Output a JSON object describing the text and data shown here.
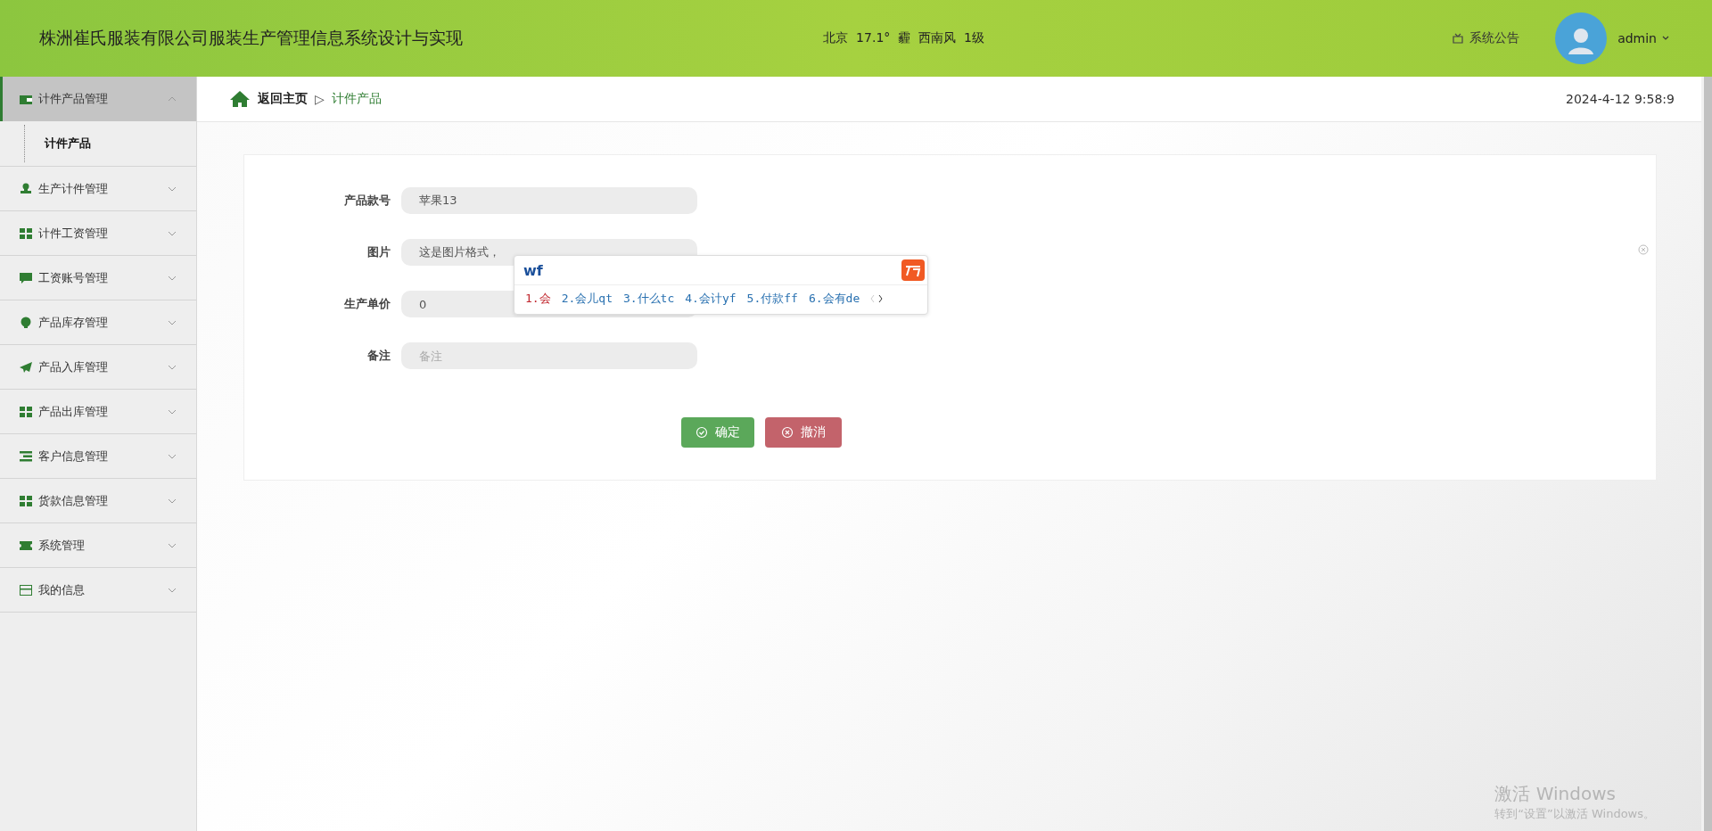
{
  "header": {
    "title": "株洲崔氏服装有限公司服装生产管理信息系统设计与实现",
    "weather": "北京  17.1°  霾  西南风  1级",
    "notice": "系统公告",
    "user": "admin"
  },
  "sidebar": {
    "items": [
      {
        "label": "计件产品管理",
        "expanded": true,
        "children": [
          {
            "label": "计件产品",
            "selected": true
          }
        ]
      },
      {
        "label": "生产计件管理",
        "expanded": false
      },
      {
        "label": "计件工资管理",
        "expanded": false
      },
      {
        "label": "工资账号管理",
        "expanded": false
      },
      {
        "label": "产品库存管理",
        "expanded": false
      },
      {
        "label": "产品入库管理",
        "expanded": false
      },
      {
        "label": "产品出库管理",
        "expanded": false
      },
      {
        "label": "客户信息管理",
        "expanded": false
      },
      {
        "label": "货款信息管理",
        "expanded": false
      },
      {
        "label": "系统管理",
        "expanded": false
      },
      {
        "label": "我的信息",
        "expanded": false
      }
    ]
  },
  "breadcrumb": {
    "home": "返回主页",
    "separator": "▷",
    "current": "计件产品",
    "datetime": "2024-4-12 9:58:9"
  },
  "form": {
    "fields": [
      {
        "label": "产品款号",
        "value": "苹果13"
      },
      {
        "label": "图片",
        "value": "这是图片格式，"
      },
      {
        "label": "生产单价",
        "value": "0"
      },
      {
        "label": "备注",
        "placeholder": "备注"
      }
    ],
    "buttons": [
      {
        "label": "确定",
        "kind": "confirm"
      },
      {
        "label": "撤消",
        "kind": "cancel"
      }
    ]
  },
  "ime": {
    "input": "wf",
    "candidates": [
      {
        "label": "1.会",
        "selected": true
      },
      {
        "label": "2.会儿qt",
        "selected": false
      },
      {
        "label": "3.什么tc",
        "selected": false
      },
      {
        "label": "4.会计yf",
        "selected": false
      },
      {
        "label": "5.付款ff",
        "selected": false
      },
      {
        "label": "6.会有de",
        "selected": false
      }
    ]
  },
  "os_overlay": {
    "title": "激活 Windows",
    "subtitle": "转到“设置”以激活 Windows。"
  }
}
